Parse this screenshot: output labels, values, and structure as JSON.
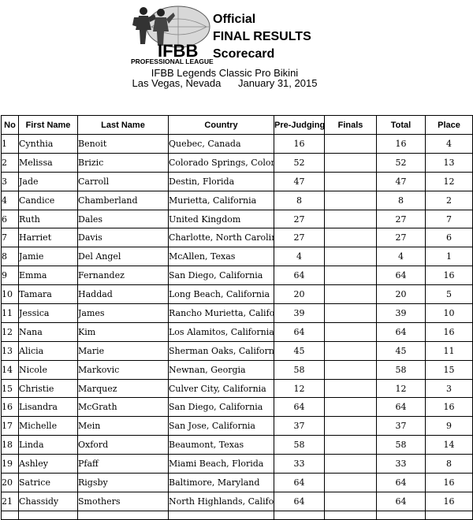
{
  "document": {
    "title_line1": "Official",
    "title_line2": "FINAL RESULTS",
    "title_line3": "Scorecard",
    "event": "IFBB Legends Classic Pro Bikini",
    "location": "Las Vegas, Nevada",
    "date": "January 31, 2015"
  },
  "logo": {
    "main": "IFBB",
    "sub": "PROFESSIONAL LEAGUE"
  },
  "table": {
    "headers": {
      "no": "No",
      "first": "First Name",
      "last": "Last Name",
      "country": "Country",
      "prejudging": "Pre-Judging",
      "finals": "Finals",
      "total": "Total",
      "place": "Place"
    },
    "rows": [
      {
        "no": "1",
        "first": "Cynthia",
        "last": "Benoit",
        "country": "Quebec, Canada",
        "prejudging": "16",
        "finals": "",
        "total": "16",
        "place": "4"
      },
      {
        "no": "2",
        "first": "Melissa",
        "last": "Brizic",
        "country": "Colorado Springs, Colorado",
        "prejudging": "52",
        "finals": "",
        "total": "52",
        "place": "13"
      },
      {
        "no": "3",
        "first": "Jade",
        "last": "Carroll",
        "country": "Destin, Florida",
        "prejudging": "47",
        "finals": "",
        "total": "47",
        "place": "12"
      },
      {
        "no": "4",
        "first": "Candice",
        "last": "Chamberland",
        "country": "Murietta, California",
        "prejudging": "8",
        "finals": "",
        "total": "8",
        "place": "2"
      },
      {
        "no": "6",
        "first": "Ruth",
        "last": "Dales",
        "country": "United Kingdom",
        "prejudging": "27",
        "finals": "",
        "total": "27",
        "place": "7"
      },
      {
        "no": "7",
        "first": "Harriet",
        "last": "Davis",
        "country": "Charlotte, North Carolina",
        "prejudging": "27",
        "finals": "",
        "total": "27",
        "place": "6"
      },
      {
        "no": "8",
        "first": "Jamie",
        "last": "Del Angel",
        "country": "McAllen, Texas",
        "prejudging": "4",
        "finals": "",
        "total": "4",
        "place": "1"
      },
      {
        "no": "9",
        "first": "Emma",
        "last": "Fernandez",
        "country": "San Diego, California",
        "prejudging": "64",
        "finals": "",
        "total": "64",
        "place": "16"
      },
      {
        "no": "10",
        "first": "Tamara",
        "last": "Haddad",
        "country": "Long Beach, California",
        "prejudging": "20",
        "finals": "",
        "total": "20",
        "place": "5"
      },
      {
        "no": "11",
        "first": "Jessica",
        "last": "James",
        "country": "Rancho Murietta, California",
        "prejudging": "39",
        "finals": "",
        "total": "39",
        "place": "10"
      },
      {
        "no": "12",
        "first": "Nana",
        "last": "Kim",
        "country": "Los Alamitos, California",
        "prejudging": "64",
        "finals": "",
        "total": "64",
        "place": "16"
      },
      {
        "no": "13",
        "first": "Alicia",
        "last": "Marie",
        "country": "Sherman Oaks, California",
        "prejudging": "45",
        "finals": "",
        "total": "45",
        "place": "11"
      },
      {
        "no": "14",
        "first": "Nicole",
        "last": "Markovic",
        "country": "Newnan, Georgia",
        "prejudging": "58",
        "finals": "",
        "total": "58",
        "place": "15"
      },
      {
        "no": "15",
        "first": "Christie",
        "last": "Marquez",
        "country": "Culver City, California",
        "prejudging": "12",
        "finals": "",
        "total": "12",
        "place": "3"
      },
      {
        "no": "16",
        "first": "Lisandra",
        "last": "McGrath",
        "country": "San Diego, California",
        "prejudging": "64",
        "finals": "",
        "total": "64",
        "place": "16"
      },
      {
        "no": "17",
        "first": "Michelle",
        "last": "Mein",
        "country": "San Jose, California",
        "prejudging": "37",
        "finals": "",
        "total": "37",
        "place": "9"
      },
      {
        "no": "18",
        "first": "Linda",
        "last": "Oxford",
        "country": "Beaumont, Texas",
        "prejudging": "58",
        "finals": "",
        "total": "58",
        "place": "14"
      },
      {
        "no": "19",
        "first": "Ashley",
        "last": "Pfaff",
        "country": "Miami Beach, Florida",
        "prejudging": "33",
        "finals": "",
        "total": "33",
        "place": "8"
      },
      {
        "no": "20",
        "first": "Satrice",
        "last": "Rigsby",
        "country": "Baltimore, Maryland",
        "prejudging": "64",
        "finals": "",
        "total": "64",
        "place": "16"
      },
      {
        "no": "21",
        "first": "Chassidy",
        "last": "Smothers",
        "country": "North Highlands, California",
        "prejudging": "64",
        "finals": "",
        "total": "64",
        "place": "16"
      }
    ]
  }
}
